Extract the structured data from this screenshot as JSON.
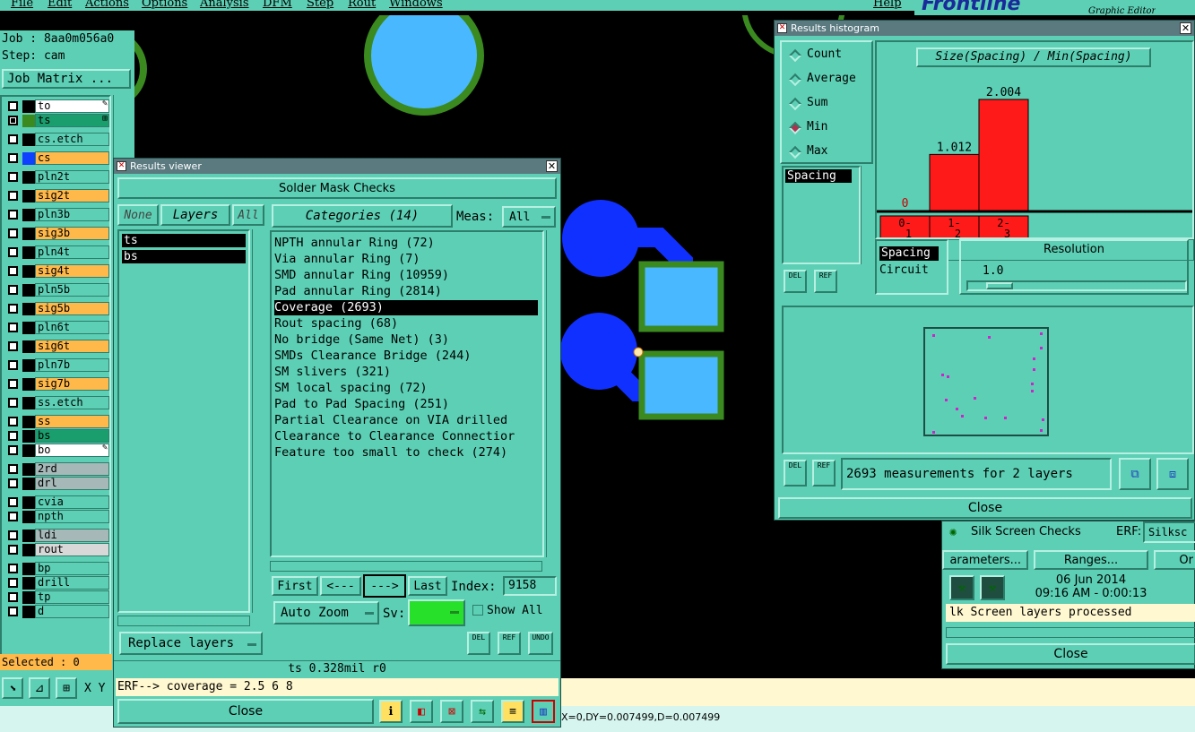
{
  "menu": {
    "items": [
      "File",
      "Edit",
      "Actions",
      "Options",
      "Analysis",
      "DFM",
      "Step",
      "Rout",
      "Windows"
    ],
    "help": "Help",
    "brand": "Frontline",
    "brand_sub": "Graphic Editor"
  },
  "job_panel": {
    "job": "Job : 8aa0m056a0",
    "step": "Step: cam",
    "job_matrix": "Job Matrix ...",
    "selected": "Selected : 0",
    "xy_label": "X Y"
  },
  "layers": [
    {
      "name": "to",
      "color": "#ffffff",
      "swatch": "#000000",
      "mark": "pen"
    },
    {
      "name": "ts",
      "color": "#1a9e6e",
      "swatch": "#3a8a20",
      "mark": "grid",
      "active": true
    },
    {
      "name": "cs.etch",
      "color": "#5ccfb4",
      "swatch": "#000000"
    },
    {
      "name": "cs",
      "color": "#ffb84a",
      "swatch": "#1040ff"
    },
    {
      "name": "pln2t",
      "color": "#5ccfb4",
      "swatch": "#000000"
    },
    {
      "name": "sig2t",
      "color": "#ffb84a",
      "swatch": "#000000"
    },
    {
      "name": "pln3b",
      "color": "#5ccfb4",
      "swatch": "#000000"
    },
    {
      "name": "sig3b",
      "color": "#ffb84a",
      "swatch": "#000000"
    },
    {
      "name": "pln4t",
      "color": "#5ccfb4",
      "swatch": "#000000"
    },
    {
      "name": "sig4t",
      "color": "#ffb84a",
      "swatch": "#000000"
    },
    {
      "name": "pln5b",
      "color": "#5ccfb4",
      "swatch": "#000000"
    },
    {
      "name": "sig5b",
      "color": "#ffb84a",
      "swatch": "#000000"
    },
    {
      "name": "pln6t",
      "color": "#5ccfb4",
      "swatch": "#000000"
    },
    {
      "name": "sig6t",
      "color": "#ffb84a",
      "swatch": "#000000"
    },
    {
      "name": "pln7b",
      "color": "#5ccfb4",
      "swatch": "#000000"
    },
    {
      "name": "sig7b",
      "color": "#ffb84a",
      "swatch": "#000000"
    },
    {
      "name": "ss.etch",
      "color": "#5ccfb4",
      "swatch": "#000000"
    },
    {
      "name": "ss",
      "color": "#ffb84a",
      "swatch": "#000000"
    },
    {
      "name": "bs",
      "color": "#1a9e6e",
      "swatch": "#000000"
    },
    {
      "name": "bo",
      "color": "#ffffff",
      "swatch": "#000000",
      "mark": "pen"
    },
    {
      "name": "2rd",
      "color": "#a6b8b8",
      "swatch": "#000000"
    },
    {
      "name": "drl",
      "color": "#a6b8b8",
      "swatch": "#000000"
    },
    {
      "name": "cvia",
      "color": "#5ccfb4",
      "swatch": "#000000"
    },
    {
      "name": "npth",
      "color": "#5ccfb4",
      "swatch": "#000000"
    },
    {
      "name": "ldi",
      "color": "#a6b8b8",
      "swatch": "#000000"
    },
    {
      "name": "rout",
      "color": "#d8d8d8",
      "swatch": "#000000"
    },
    {
      "name": "bp",
      "color": "#5ccfb4",
      "swatch": "#000000"
    },
    {
      "name": "drill",
      "color": "#5ccfb4",
      "swatch": "#000000"
    },
    {
      "name": "tp",
      "color": "#5ccfb4",
      "swatch": "#000000"
    },
    {
      "name": "d",
      "color": "#5ccfb4",
      "swatch": "#000000"
    }
  ],
  "results_viewer": {
    "title": "Results viewer",
    "header": "Solder Mask Checks",
    "none_btn": "None",
    "layers_btn": "Layers",
    "all_btn": "All",
    "selected_layers": [
      "ts",
      "bs"
    ],
    "categories_btn": "Categories (14)",
    "meas_label": "Meas:",
    "meas_value": "All",
    "categories": [
      "NPTH annular Ring (72)",
      "Via annular Ring (7)",
      "SMD annular Ring (10959)",
      "Pad annular Ring (2814)",
      "Coverage (2693)",
      "Rout spacing (68)",
      "No bridge (Same Net) (3)",
      "SMDs Clearance Bridge (244)",
      "SM slivers (321)",
      "SM local spacing (72)",
      "Pad to Pad Spacing (251)",
      "Partial Clearance on VIA drilled",
      "Clearance to Clearance Connectior",
      "Feature too small to check (274)"
    ],
    "selected_category_index": 4,
    "first": "First",
    "prev": "<---",
    "next": "--->",
    "last": "Last",
    "index_label": "Index:",
    "index_value": "9158",
    "auto_zoom": "Auto Zoom",
    "sv_label": "Sv:",
    "show_all": "Show All",
    "replace_layers": "Replace layers",
    "del": "DEL",
    "ref": "REF",
    "undo": "UNDO",
    "status": "ts 0.328mil  r0",
    "erf_line": "ERF--> coverage = 2.5 6 8",
    "close": "Close"
  },
  "histogram": {
    "title": "Results histogram",
    "modes": [
      "Count",
      "Average",
      "Sum",
      "Min",
      "Max"
    ],
    "selected_mode": "Min",
    "measure_list": [
      "Spacing"
    ],
    "chart_title": "Size(Spacing) / Min(Spacing)",
    "bins": [
      {
        "label": "0-\n1",
        "value": 0,
        "label_top": "0"
      },
      {
        "label": "1-\n2",
        "value": 1.012,
        "label_top": "1.012"
      },
      {
        "label": "2-\n3",
        "value": 2.004,
        "label_top": "2.004"
      }
    ],
    "bin_line1": [
      "0-",
      "1-",
      "2-"
    ],
    "bin_line2": [
      "1",
      "2",
      "3"
    ],
    "type_list": [
      "Spacing",
      "Circuit"
    ],
    "resolution_label": "Resolution",
    "resolution_value": "1.0",
    "measurements_text": "2693 measurements for 2 layers",
    "del": "DEL",
    "ref": "REF",
    "close": "Close"
  },
  "silk_panel": {
    "title": "Silk Screen Checks",
    "erf_label": "ERF:",
    "erf_value": "Silksc",
    "parameters": "arameters...",
    "ranges": "Ranges...",
    "other": "Or",
    "date": "06 Jun 2014",
    "time": "09:16 AM - 0:00:13",
    "status": "lk Screen layers processed",
    "close": "Close"
  },
  "status_bar": {
    "coords": "X=0,DY=0.007499,D=0.007499"
  },
  "colors": {
    "panel": "#5ccfb4",
    "canvas": "#000000",
    "pad_outline": "#3a8a20",
    "pad_fill": "#4ab8ff",
    "trace": "#1030ff",
    "bar": "#ff1a1a",
    "selection": "#000000"
  }
}
